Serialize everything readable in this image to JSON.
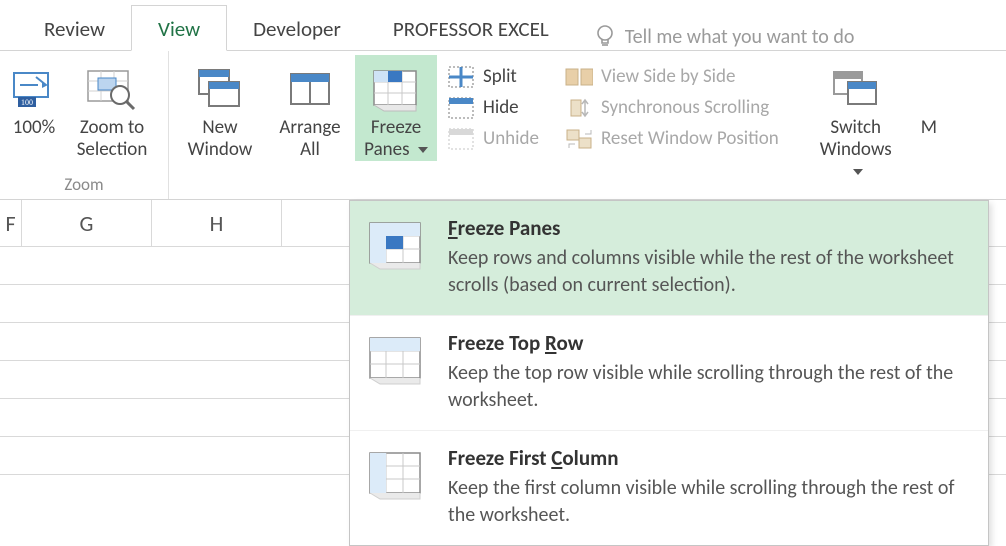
{
  "tabs": {
    "review": "Review",
    "view": "View",
    "developer": "Developer",
    "profexcel": "PROFESSOR EXCEL",
    "tellme": "Tell me what you want to do"
  },
  "ribbon": {
    "zoom_group_label": "Zoom",
    "pct100": "100%",
    "zoom_to_selection_l1": "Zoom to",
    "zoom_to_selection_l2": "Selection",
    "new_window_l1": "New",
    "new_window_l2": "Window",
    "arrange_all_l1": "Arrange",
    "arrange_all_l2": "All",
    "freeze_panes_l1": "Freeze",
    "freeze_panes_l2": "Panes",
    "split": "Split",
    "hide": "Hide",
    "unhide": "Unhide",
    "view_side": "View Side by Side",
    "sync_scroll": "Synchronous Scrolling",
    "reset_pos": "Reset Window Position",
    "switch_win_l1": "Switch",
    "switch_win_l2": "Windows"
  },
  "columns": {
    "f": "F",
    "g": "G",
    "h": "H"
  },
  "menu": {
    "fp_title_pre": "",
    "fp_title_u": "F",
    "fp_title_post": "reeze Panes",
    "fp_desc": "Keep rows and columns visible while the rest of the worksheet scrolls (based on current selection).",
    "tr_title_pre": "Freeze Top ",
    "tr_title_u": "R",
    "tr_title_post": "ow",
    "tr_desc": "Keep the top row visible while scrolling through the rest of the worksheet.",
    "fc_title_pre": "Freeze First ",
    "fc_title_u": "C",
    "fc_title_post": "olumn",
    "fc_desc": "Keep the first column visible while scrolling through the rest of the worksheet."
  }
}
